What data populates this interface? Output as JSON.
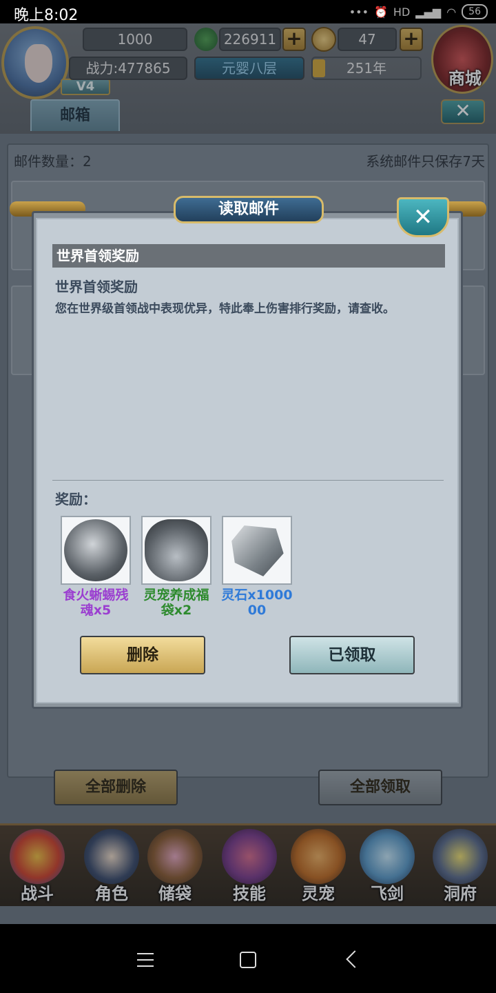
{
  "status_bar": {
    "time": "晚上8:02",
    "network": "HD",
    "battery": "56"
  },
  "top_bar": {
    "vip_level": "V4",
    "currency_1": "1000",
    "jade_amount": "226911",
    "coin_amount": "47",
    "combat_power": "战力:477865",
    "realm": "元婴八层",
    "years": "251年",
    "shop_label": "商城"
  },
  "mailbox": {
    "tab_label": "邮箱",
    "count_label": "邮件数量：2",
    "retention_note": "系统邮件只保存7天",
    "delete_all_label": "全部删除",
    "claim_all_label": "全部领取"
  },
  "modal": {
    "title": "读取邮件",
    "subject_header": "世界首领奖励",
    "subject_title": "世界首领奖励",
    "body": "您在世界级首领战中表现优异，特此奉上伤害排行奖励，请查收。",
    "rewards_label": "奖励：",
    "rewards": [
      {
        "name": "食火蜥蜴残魂x5",
        "color": "#9b3fd0",
        "icon": "soul-orb-icon"
      },
      {
        "name": "灵宠养成福袋x2",
        "color": "#2d8a2d",
        "icon": "lucky-bag-icon"
      },
      {
        "name": "灵石x100000",
        "color": "#2f7ad8",
        "icon": "spirit-stone-icon"
      }
    ],
    "delete_label": "删除",
    "claimed_label": "已领取"
  },
  "bottom_nav": [
    {
      "label": "战斗",
      "icon": "battle-icon"
    },
    {
      "label": "角色",
      "icon": "character-icon"
    },
    {
      "label": "储袋",
      "icon": "storage-bag-icon"
    },
    {
      "label": "技能",
      "icon": "skill-icon"
    },
    {
      "label": "灵宠",
      "icon": "spirit-pet-icon"
    },
    {
      "label": "飞剑",
      "icon": "flying-sword-icon"
    },
    {
      "label": "洞府",
      "icon": "cave-dwelling-icon"
    }
  ],
  "colors": {
    "accent_gold": "#c9a654",
    "rare_purple": "#9b3fd0",
    "uncommon_green": "#2d8a2d",
    "common_blue": "#2f7ad8"
  }
}
